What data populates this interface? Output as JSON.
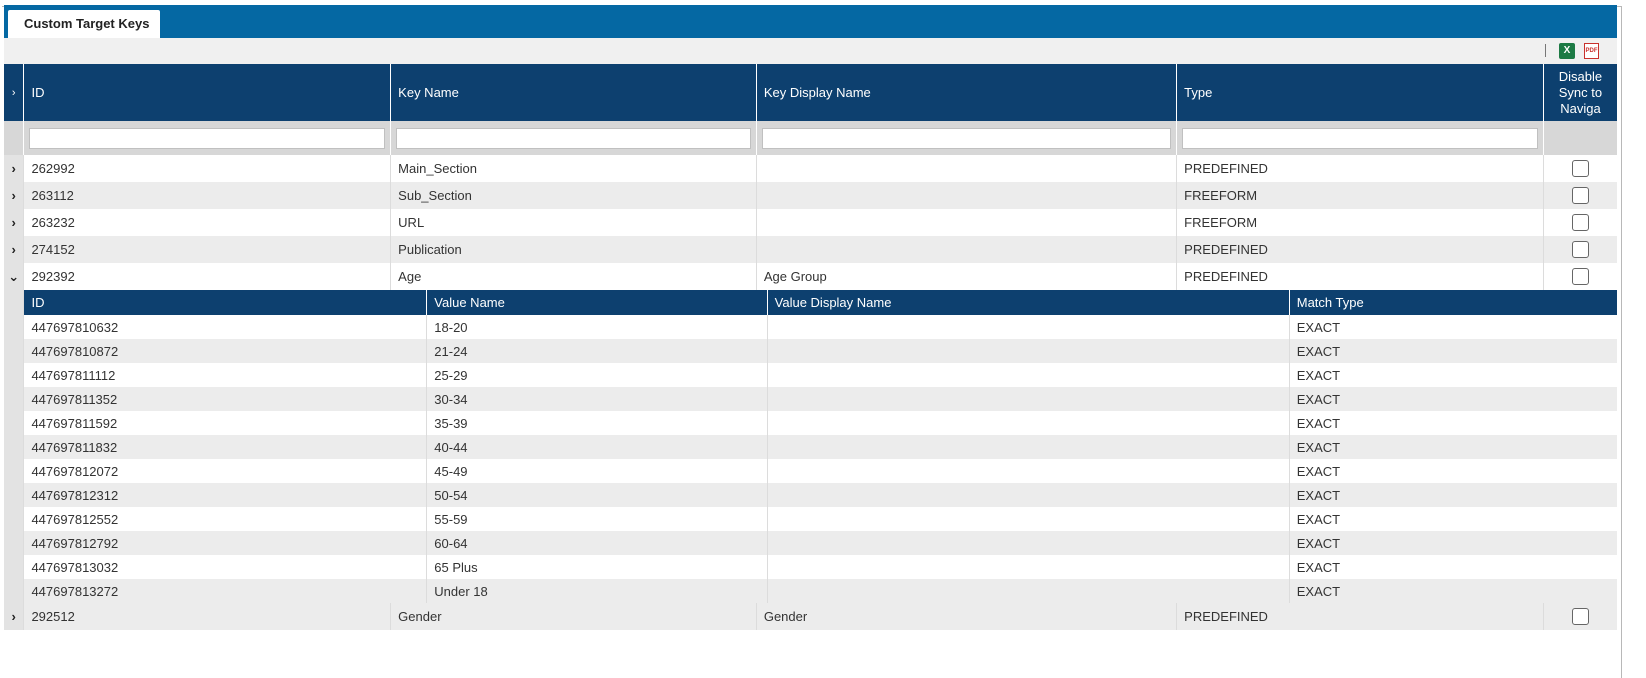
{
  "tab": {
    "label": "Custom Target Keys"
  },
  "toolbar": {
    "excel_icon": "excel-export-icon",
    "pdf_icon": "pdf-export-icon",
    "excel_glyph": "X",
    "pdf_glyph": "PDF"
  },
  "glyphs": {
    "collapsed": "›",
    "expanded": "⌄"
  },
  "columns": {
    "id": "ID",
    "key_name": "Key Name",
    "key_display_name": "Key Display Name",
    "type": "Type",
    "disable_sync": "Disable Sync to Naviga"
  },
  "rows": [
    {
      "id": "262992",
      "key_name": "Main_Section",
      "key_display_name": "",
      "type": "PREDEFINED",
      "checked": false
    },
    {
      "id": "263112",
      "key_name": "Sub_Section",
      "key_display_name": "",
      "type": "FREEFORM",
      "checked": false
    },
    {
      "id": "263232",
      "key_name": "URL",
      "key_display_name": "",
      "type": "FREEFORM",
      "checked": false
    },
    {
      "id": "274152",
      "key_name": "Publication",
      "key_display_name": "",
      "type": "PREDEFINED",
      "checked": false
    },
    {
      "id": "292392",
      "key_name": "Age",
      "key_display_name": "Age Group",
      "type": "PREDEFINED",
      "checked": false,
      "expanded": true
    },
    {
      "id": "292512",
      "key_name": "Gender",
      "key_display_name": "Gender",
      "type": "PREDEFINED",
      "checked": false
    }
  ],
  "sub_columns": {
    "id": "ID",
    "value_name": "Value Name",
    "value_display_name": "Value Display Name",
    "match_type": "Match Type"
  },
  "sub_rows": [
    {
      "id": "447697810632",
      "value_name": "18-20",
      "value_display_name": "",
      "match_type": "EXACT"
    },
    {
      "id": "447697810872",
      "value_name": "21-24",
      "value_display_name": "",
      "match_type": "EXACT"
    },
    {
      "id": "447697811112",
      "value_name": "25-29",
      "value_display_name": "",
      "match_type": "EXACT"
    },
    {
      "id": "447697811352",
      "value_name": "30-34",
      "value_display_name": "",
      "match_type": "EXACT"
    },
    {
      "id": "447697811592",
      "value_name": "35-39",
      "value_display_name": "",
      "match_type": "EXACT"
    },
    {
      "id": "447697811832",
      "value_name": "40-44",
      "value_display_name": "",
      "match_type": "EXACT"
    },
    {
      "id": "447697812072",
      "value_name": "45-49",
      "value_display_name": "",
      "match_type": "EXACT"
    },
    {
      "id": "447697812312",
      "value_name": "50-54",
      "value_display_name": "",
      "match_type": "EXACT"
    },
    {
      "id": "447697812552",
      "value_name": "55-59",
      "value_display_name": "",
      "match_type": "EXACT"
    },
    {
      "id": "447697812792",
      "value_name": "60-64",
      "value_display_name": "",
      "match_type": "EXACT"
    },
    {
      "id": "447697813032",
      "value_name": "65 Plus",
      "value_display_name": "",
      "match_type": "EXACT"
    },
    {
      "id": "447697813272",
      "value_name": "Under 18",
      "value_display_name": "",
      "match_type": "EXACT"
    }
  ]
}
